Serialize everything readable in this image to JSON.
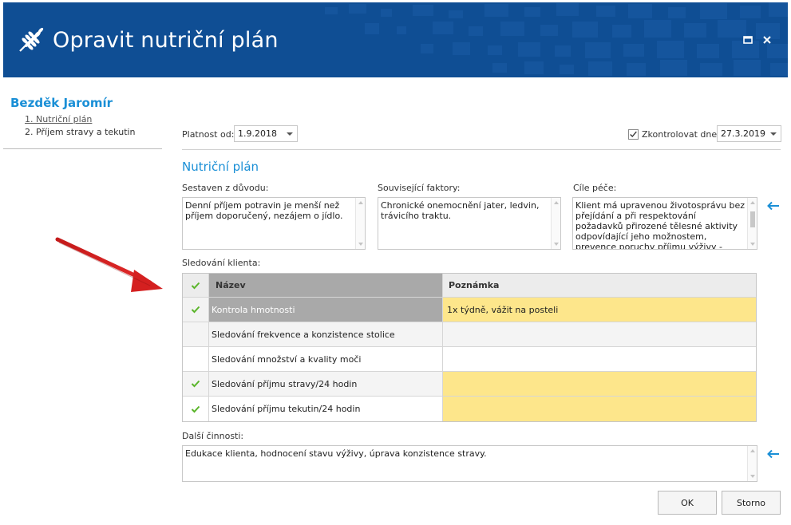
{
  "window": {
    "title": "Opravit nutriční plán",
    "brand_color": "#0f4e94",
    "icon": "wheat-icon"
  },
  "client": {
    "name": "Bezděk Jaromír"
  },
  "nav": {
    "items": [
      {
        "label": "1. Nutriční plán",
        "active": true
      },
      {
        "label": "2. Příjem stravy a tekutin",
        "active": false
      }
    ]
  },
  "validity": {
    "label": "Platnost od:",
    "value": "1.9.2018"
  },
  "check_date": {
    "label": "Zkontrolovat dne:",
    "checked": true,
    "value": "27.3.2019"
  },
  "section_title": "Nutriční plán",
  "fields": {
    "reason": {
      "label": "Sestaven z důvodu:",
      "value": "Denní příjem potravin je menší než příjem doporučený, nezájem o jídlo."
    },
    "factors": {
      "label": "Související faktory:",
      "value": "Chronické onemocnění jater, ledvin, trávicího traktu."
    },
    "goals": {
      "label": "Cíle péče:",
      "value": "Klient má upravenou životosprávu bez přejídání a při respektování požadavků přirozené tělesné aktivity odpovídající jeho možnostem, prevence poruchy příjmu výživy - stravy."
    }
  },
  "monitoring": {
    "label": "Sledování klienta:",
    "columns": {
      "name": "Název",
      "note": "Poznámka"
    },
    "rows": [
      {
        "checked": true,
        "name": "Kontrola hmotnosti",
        "note": "1x týdně, vážit na posteli",
        "selected": true,
        "note_highlight": true
      },
      {
        "checked": false,
        "name": "Sledování frekvence a konzistence stolice",
        "note": "",
        "selected": false,
        "note_highlight": false
      },
      {
        "checked": false,
        "name": "Sledování množství a kvality moči",
        "note": "",
        "selected": false,
        "note_highlight": false
      },
      {
        "checked": true,
        "name": "Sledování příjmu stravy/24 hodin",
        "note": "",
        "selected": false,
        "note_highlight": true
      },
      {
        "checked": true,
        "name": "Sledování příjmu tekutin/24 hodin",
        "note": "",
        "selected": false,
        "note_highlight": true
      }
    ],
    "highlight_color": "#fde68b",
    "check_color": "#5ab52a"
  },
  "other_activities": {
    "label": "Další činnosti:",
    "value": "Edukace klienta, hodnocení stavu výživy, úprava konzistence stravy."
  },
  "buttons": {
    "ok": "OK",
    "cancel": "Storno"
  },
  "annotation": {
    "arrow_color": "#d42020"
  }
}
